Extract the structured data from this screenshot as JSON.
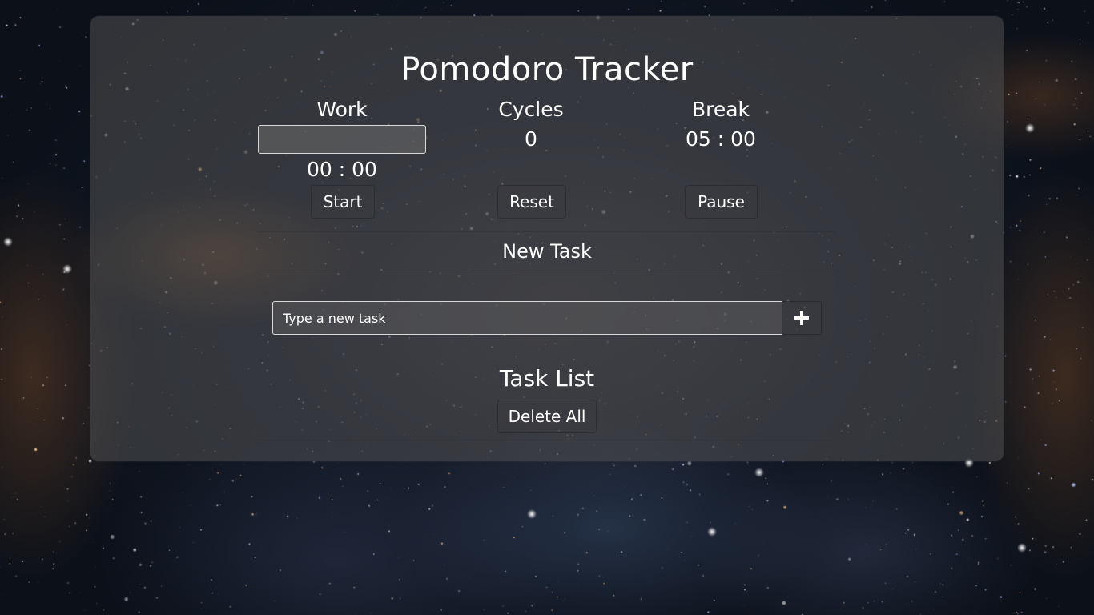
{
  "app": {
    "title": "Pomodoro Tracker"
  },
  "timer": {
    "work": {
      "label": "Work",
      "input_value": "",
      "time": "00 : 00",
      "button": "Start"
    },
    "cycles": {
      "label": "Cycles",
      "count": "0",
      "button": "Reset"
    },
    "break": {
      "label": "Break",
      "time": "05 : 00",
      "button": "Pause"
    }
  },
  "new_task": {
    "title": "New Task",
    "placeholder": "Type a new task",
    "add_icon": "plus-icon"
  },
  "task_list": {
    "title": "Task List",
    "delete_all_label": "Delete All"
  },
  "colors": {
    "text": "#ffffff",
    "panel": "#4e4e50",
    "background": "#0f1623"
  }
}
